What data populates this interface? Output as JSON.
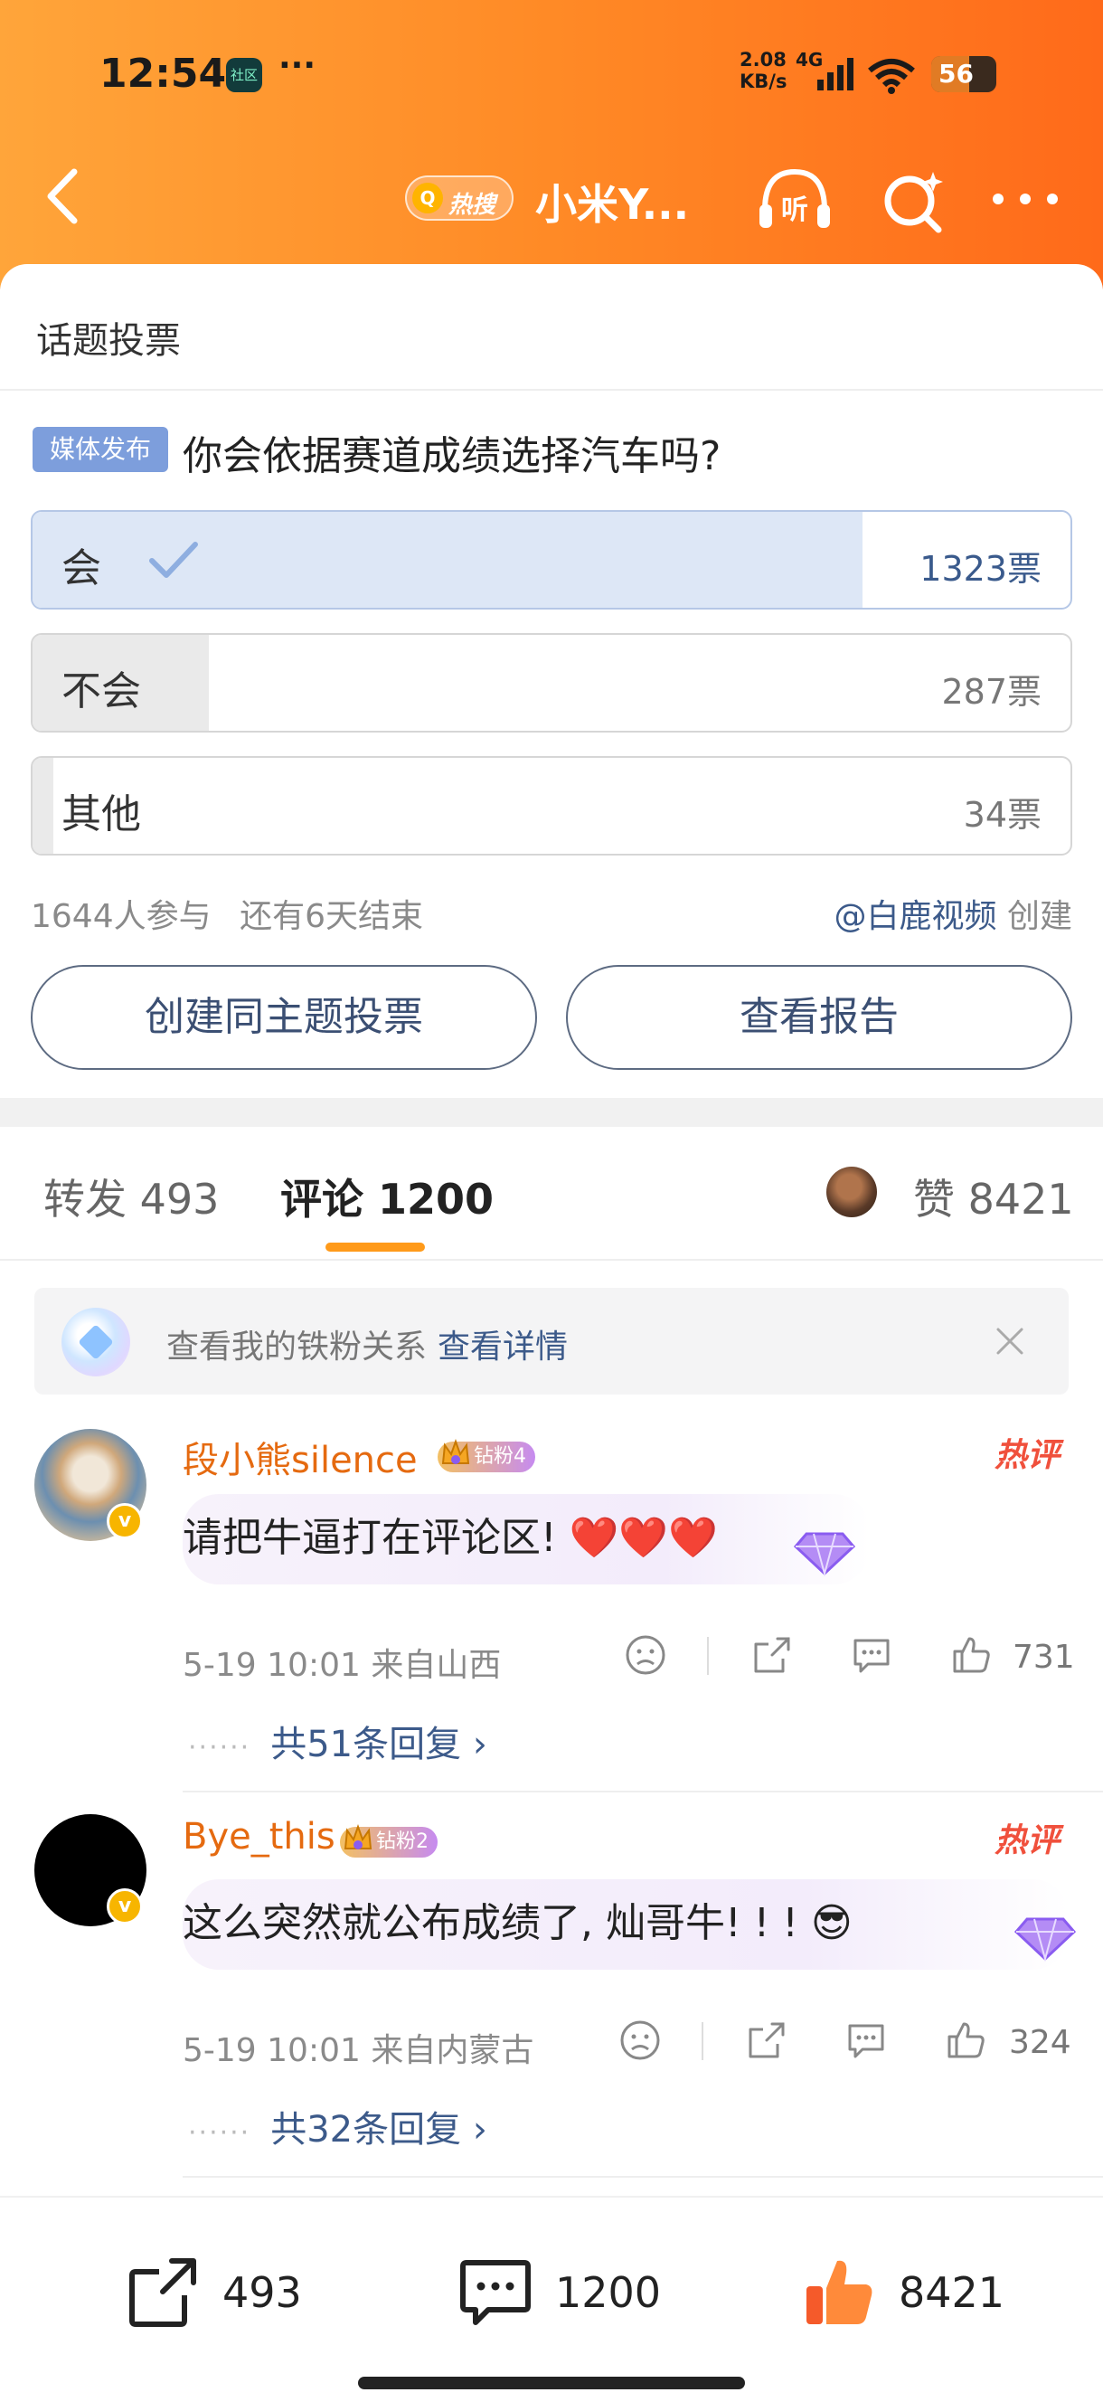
{
  "status_bar": {
    "time": "12:54",
    "app_chip": "社区",
    "dots": "···",
    "net_speed": "2.08\nKB/s",
    "net_type": "4G",
    "battery": "56"
  },
  "nav": {
    "hot_badge": "热搜",
    "title": "小米Y...",
    "listen_label": "听"
  },
  "vote": {
    "header": "话题投票",
    "tag": "媒体发布",
    "question": "你会依据赛道成绩选择汽车吗?",
    "options": [
      {
        "label": "会",
        "count": "1323票",
        "share": 0.8,
        "selected": true
      },
      {
        "label": "不会",
        "count": "287票",
        "share": 0.17,
        "selected": false
      },
      {
        "label": "其他",
        "count": "34票",
        "share": 0.02,
        "selected": false
      }
    ],
    "participants": "1644人参与",
    "remaining": "还有6天结束",
    "creator_name": "@白鹿视频",
    "creator_suffix": "创建",
    "create_button": "创建同主题投票",
    "report_button": "查看报告"
  },
  "tabs": {
    "repost": "转发 493",
    "comments": "评论 1200",
    "likes": "赞 8421"
  },
  "fans_banner": {
    "text": "查看我的铁粉关系",
    "link": "查看详情"
  },
  "comments": [
    {
      "user": "段小熊silence",
      "fan_badge": "钻粉4",
      "hot_tag": "热评",
      "text": "请把牛逼打在评论区! ❤️❤️❤️",
      "time_place": "5-19 10:01 来自山西",
      "likes": "731",
      "replies": "共51条回复 ›"
    },
    {
      "user": "Bye_this",
      "fan_badge": "钻粉2",
      "hot_tag": "热评",
      "text": "这么突然就公布成绩了, 灿哥牛! ! ! 😎",
      "time_place": "5-19 10:01 来自内蒙古",
      "likes": "324",
      "replies": "共32条回复 ›"
    }
  ],
  "bottom_bar": {
    "repost": "493",
    "comment": "1200",
    "like": "8421"
  },
  "colors": {
    "header_start": "#ffa53a",
    "header_end": "#ff6a1a",
    "link": "#3c5a8a",
    "username": "#e56a10",
    "hot": "#f0503c",
    "tab_underline": "#ff9a1a"
  },
  "icons": [
    "back-icon",
    "listen-icon",
    "search-ai-icon",
    "more-icon",
    "check-icon",
    "close-icon",
    "dislike-icon",
    "share-icon",
    "comment-icon",
    "like-icon"
  ]
}
